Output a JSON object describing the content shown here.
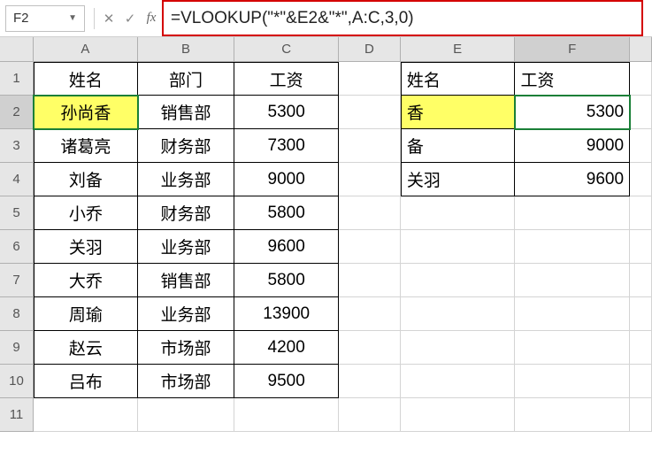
{
  "formulaBar": {
    "nameBox": "F2",
    "formula": "=VLOOKUP(\"*\"&E2&\"*\",A:C,3,0)",
    "fxLabel": "fx"
  },
  "columns": [
    "A",
    "B",
    "C",
    "D",
    "E",
    "F",
    ""
  ],
  "rowHeaders": [
    "1",
    "2",
    "3",
    "4",
    "5",
    "6",
    "7",
    "8",
    "9",
    "10",
    "11"
  ],
  "headers": {
    "A": "姓名",
    "B": "部门",
    "C": "工资",
    "E": "姓名",
    "F": "工资"
  },
  "tableLeft": [
    {
      "A": "孙尚香",
      "B": "销售部",
      "C": "5300"
    },
    {
      "A": "诸葛亮",
      "B": "财务部",
      "C": "7300"
    },
    {
      "A": "刘备",
      "B": "业务部",
      "C": "9000"
    },
    {
      "A": "小乔",
      "B": "财务部",
      "C": "5800"
    },
    {
      "A": "关羽",
      "B": "业务部",
      "C": "9600"
    },
    {
      "A": "大乔",
      "B": "销售部",
      "C": "5800"
    },
    {
      "A": "周瑜",
      "B": "业务部",
      "C": "13900"
    },
    {
      "A": "赵云",
      "B": "市场部",
      "C": "4200"
    },
    {
      "A": "吕布",
      "B": "市场部",
      "C": "9500"
    }
  ],
  "tableRight": [
    {
      "E": "香",
      "F": "5300"
    },
    {
      "E": "备",
      "F": "9000"
    },
    {
      "E": "关羽",
      "F": "9600"
    }
  ],
  "activeCell": "F2",
  "chart_data": null
}
